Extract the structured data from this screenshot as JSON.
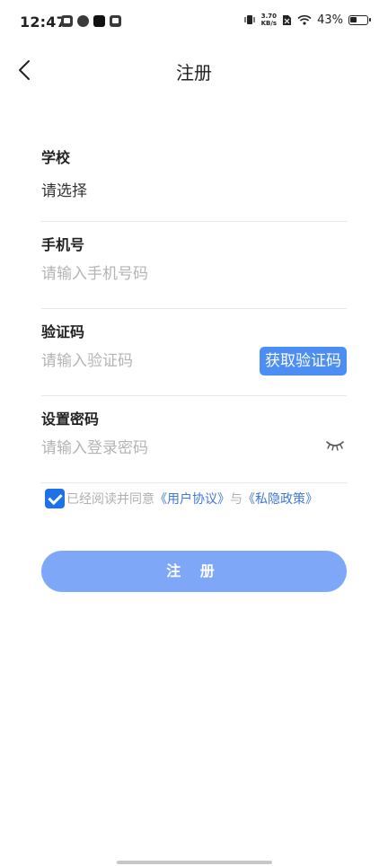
{
  "status_bar": {
    "time": "12:47",
    "net_speed_value": "3.70",
    "net_speed_unit": "KB/s",
    "battery_percent": "43%",
    "battery_level": 0.43
  },
  "nav": {
    "title": "注册"
  },
  "form": {
    "school": {
      "label": "学校",
      "value": "请选择"
    },
    "phone": {
      "label": "手机号",
      "placeholder": "请输入手机号码"
    },
    "code": {
      "label": "验证码",
      "placeholder": "请输入验证码",
      "button": "获取验证码"
    },
    "password": {
      "label": "设置密码",
      "placeholder": "请输入登录密码"
    }
  },
  "agreement": {
    "checked": true,
    "text_prefix": "已经阅读并同意",
    "user_agreement": "《用户协议》",
    "conjunction": "与",
    "privacy_policy": "《私隐政策》"
  },
  "submit_label": "注 册",
  "colors": {
    "accent": "#4d8ef5",
    "submit_bg": "#7ea7f8",
    "link": "#3f78d4"
  }
}
